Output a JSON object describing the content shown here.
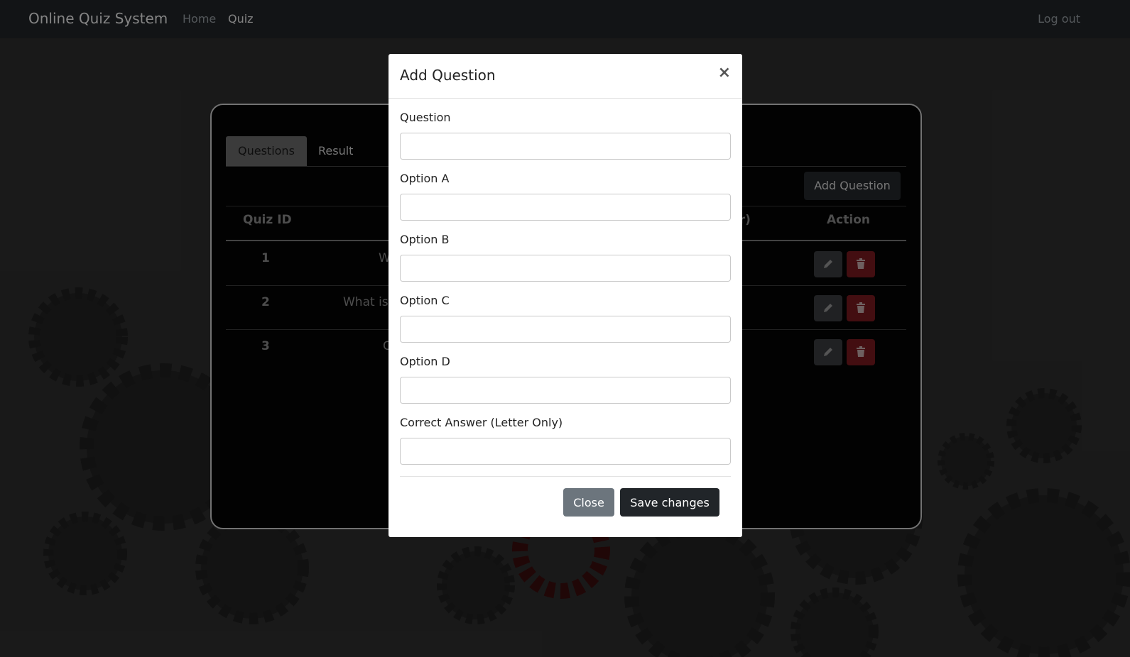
{
  "navbar": {
    "brand": "Online Quiz System",
    "home": "Home",
    "quiz": "Quiz",
    "logout": "Log out"
  },
  "tabs": {
    "questions": "Questions",
    "result": "Result"
  },
  "add_question_button": "Add Question",
  "table": {
    "headers": {
      "quiz_id": "Quiz ID",
      "answer_partial": "tter)",
      "action": "Action"
    },
    "rows": [
      {
        "id": "1",
        "question_partial": "W"
      },
      {
        "id": "2",
        "question_partial": "What is"
      },
      {
        "id": "3",
        "question_partial": "C"
      }
    ]
  },
  "modal": {
    "title": "Add Question",
    "close_symbol": "×",
    "fields": [
      {
        "label": "Question",
        "value": ""
      },
      {
        "label": "Option A",
        "value": ""
      },
      {
        "label": "Option B",
        "value": ""
      },
      {
        "label": "Option C",
        "value": ""
      },
      {
        "label": "Option D",
        "value": ""
      },
      {
        "label": "Correct Answer (Letter Only)",
        "value": ""
      }
    ],
    "close_button": "Close",
    "save_button": "Save changes"
  },
  "icons": {
    "edit": "pencil-icon",
    "delete": "trash-icon",
    "close": "close-icon"
  },
  "colors": {
    "navbar": "#212529",
    "delete_button": "#dc3545",
    "close_button": "#6c757d",
    "save_button": "#212529"
  }
}
